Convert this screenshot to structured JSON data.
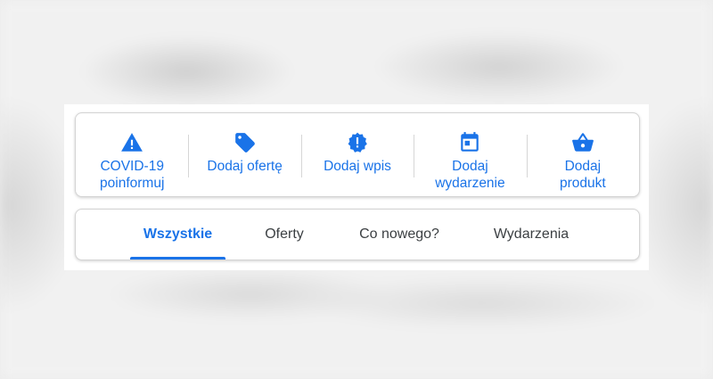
{
  "actions": [
    {
      "label": "COVID-19\npoinformuj",
      "icon": "warning-icon"
    },
    {
      "label": "Dodaj ofertę",
      "icon": "tag-icon"
    },
    {
      "label": "Dodaj wpis",
      "icon": "alert-badge-icon"
    },
    {
      "label": "Dodaj\nwydarzenie",
      "icon": "calendar-icon"
    },
    {
      "label": "Dodaj\nprodukt",
      "icon": "basket-icon"
    }
  ],
  "tabs": [
    {
      "label": "Wszystkie",
      "active": true
    },
    {
      "label": "Oferty",
      "active": false
    },
    {
      "label": "Co nowego?",
      "active": false
    },
    {
      "label": "Wydarzenia",
      "active": false
    }
  ],
  "colors": {
    "accent": "#1a73e8",
    "text": "#3c4043",
    "divider": "#d6d6d6"
  }
}
